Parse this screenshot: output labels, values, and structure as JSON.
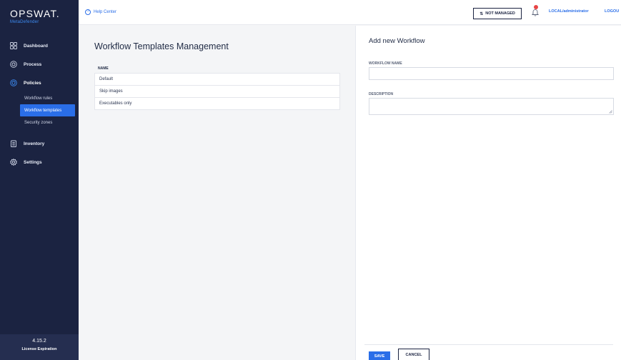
{
  "brand": {
    "name": "OPSWAT.",
    "product": "MetaDefender"
  },
  "sidebar": {
    "items": [
      {
        "label": "Dashboard",
        "icon": "grid-icon"
      },
      {
        "label": "Process",
        "icon": "target-icon"
      },
      {
        "label": "Policies",
        "icon": "shield-icon"
      },
      {
        "label": "Inventory",
        "icon": "clipboard-icon"
      },
      {
        "label": "Settings",
        "icon": "gear-icon"
      }
    ],
    "policies_sub": [
      {
        "label": "Workflow rules"
      },
      {
        "label": "Workflow templates"
      },
      {
        "label": "Security zones"
      }
    ],
    "footer": {
      "version": "4.15.2",
      "license": "License Expiration"
    }
  },
  "topbar": {
    "help": "Help Center",
    "not_managed": "NOT MANAGED",
    "user": "LOCAL/administrator",
    "logout": "LOGOU"
  },
  "main": {
    "title": "Workflow Templates Management",
    "column_header": "NAME",
    "rows": [
      "Default",
      "Skip images",
      "Executables only"
    ]
  },
  "panel": {
    "title": "Add new Workflow",
    "name_label": "WORKFLOW NAME",
    "name_value": "",
    "description_label": "DESCRIPTION",
    "description_value": "",
    "save": "SAVE",
    "cancel": "CANCEL"
  },
  "colors": {
    "sidebar_bg": "#1b2341",
    "accent": "#2a6ee8",
    "alert": "#e84545"
  }
}
